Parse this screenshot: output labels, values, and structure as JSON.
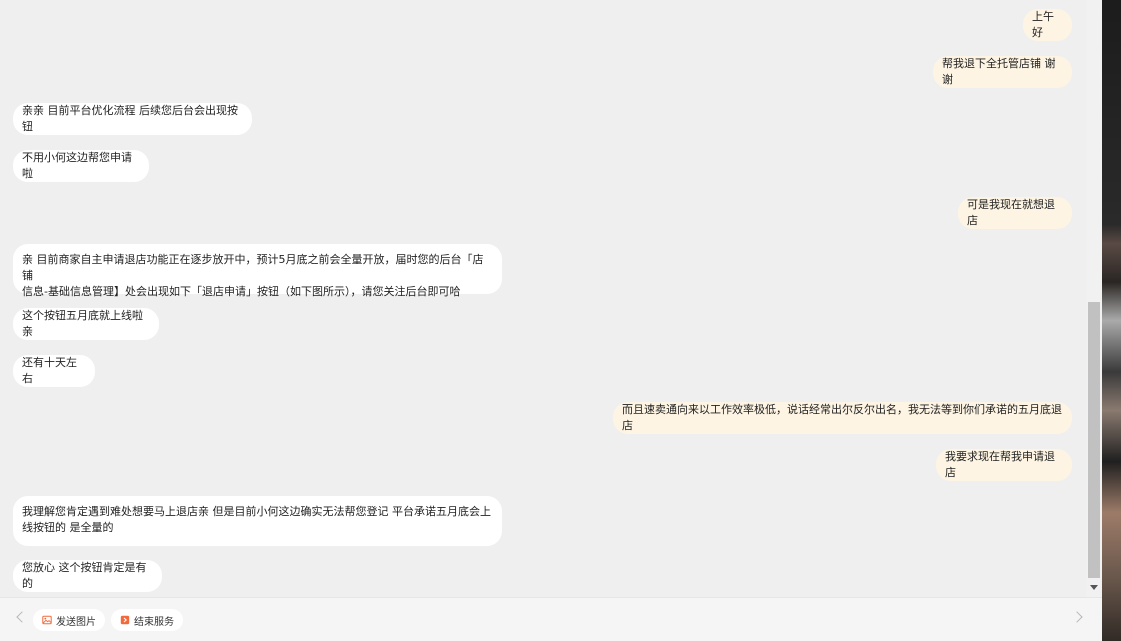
{
  "messages": [
    {
      "id": "m1",
      "side": "out",
      "text": "上午好"
    },
    {
      "id": "m2",
      "side": "out",
      "text": "帮我退下全托管店铺 谢谢"
    },
    {
      "id": "m3",
      "side": "in",
      "text": "亲亲 目前平台优化流程 后续您后台会出现按钮"
    },
    {
      "id": "m4",
      "side": "in",
      "text": "不用小何这边帮您申请啦"
    },
    {
      "id": "m5",
      "side": "out",
      "text": "可是我现在就想退店"
    },
    {
      "id": "m6",
      "side": "in",
      "line1": "亲  目前商家自主申请退店功能正在逐步放开中，预计5月底之前会全量开放，届时您的后台「店铺",
      "line2": "信息-基础信息管理】处会出现如下「退店申请」按钮（如下图所示），请您关注后台即可哈"
    },
    {
      "id": "m7",
      "side": "in",
      "text": "这个按钮五月底就上线啦亲"
    },
    {
      "id": "m8",
      "side": "in",
      "text": "还有十天左右"
    },
    {
      "id": "m9",
      "side": "out",
      "text": "而且速卖通向来以工作效率极低，说话经常出尔反尔出名，我无法等到你们承诺的五月底退店"
    },
    {
      "id": "m10",
      "side": "out",
      "text": "我要求现在帮我申请退店"
    },
    {
      "id": "m11",
      "side": "in",
      "line1": "我理解您肯定遇到难处想要马上退店亲  但是目前小何这边确实无法帮您登记 平台承诺五月底会上",
      "line2": "线按钮的 是全量的"
    },
    {
      "id": "m12",
      "side": "in",
      "text": "您放心 这个按钮肯定是有的"
    }
  ],
  "toolbar": {
    "send_image_label": "发送图片",
    "send_image_icon": "image-icon",
    "end_service_label": "结束服务",
    "end_service_icon": "exit-icon"
  },
  "colors": {
    "background": "#efefef",
    "incoming_bubble": "#ffffff",
    "outgoing_bubble": "#fdf4e3",
    "icon_accent": "#f26a3b"
  }
}
